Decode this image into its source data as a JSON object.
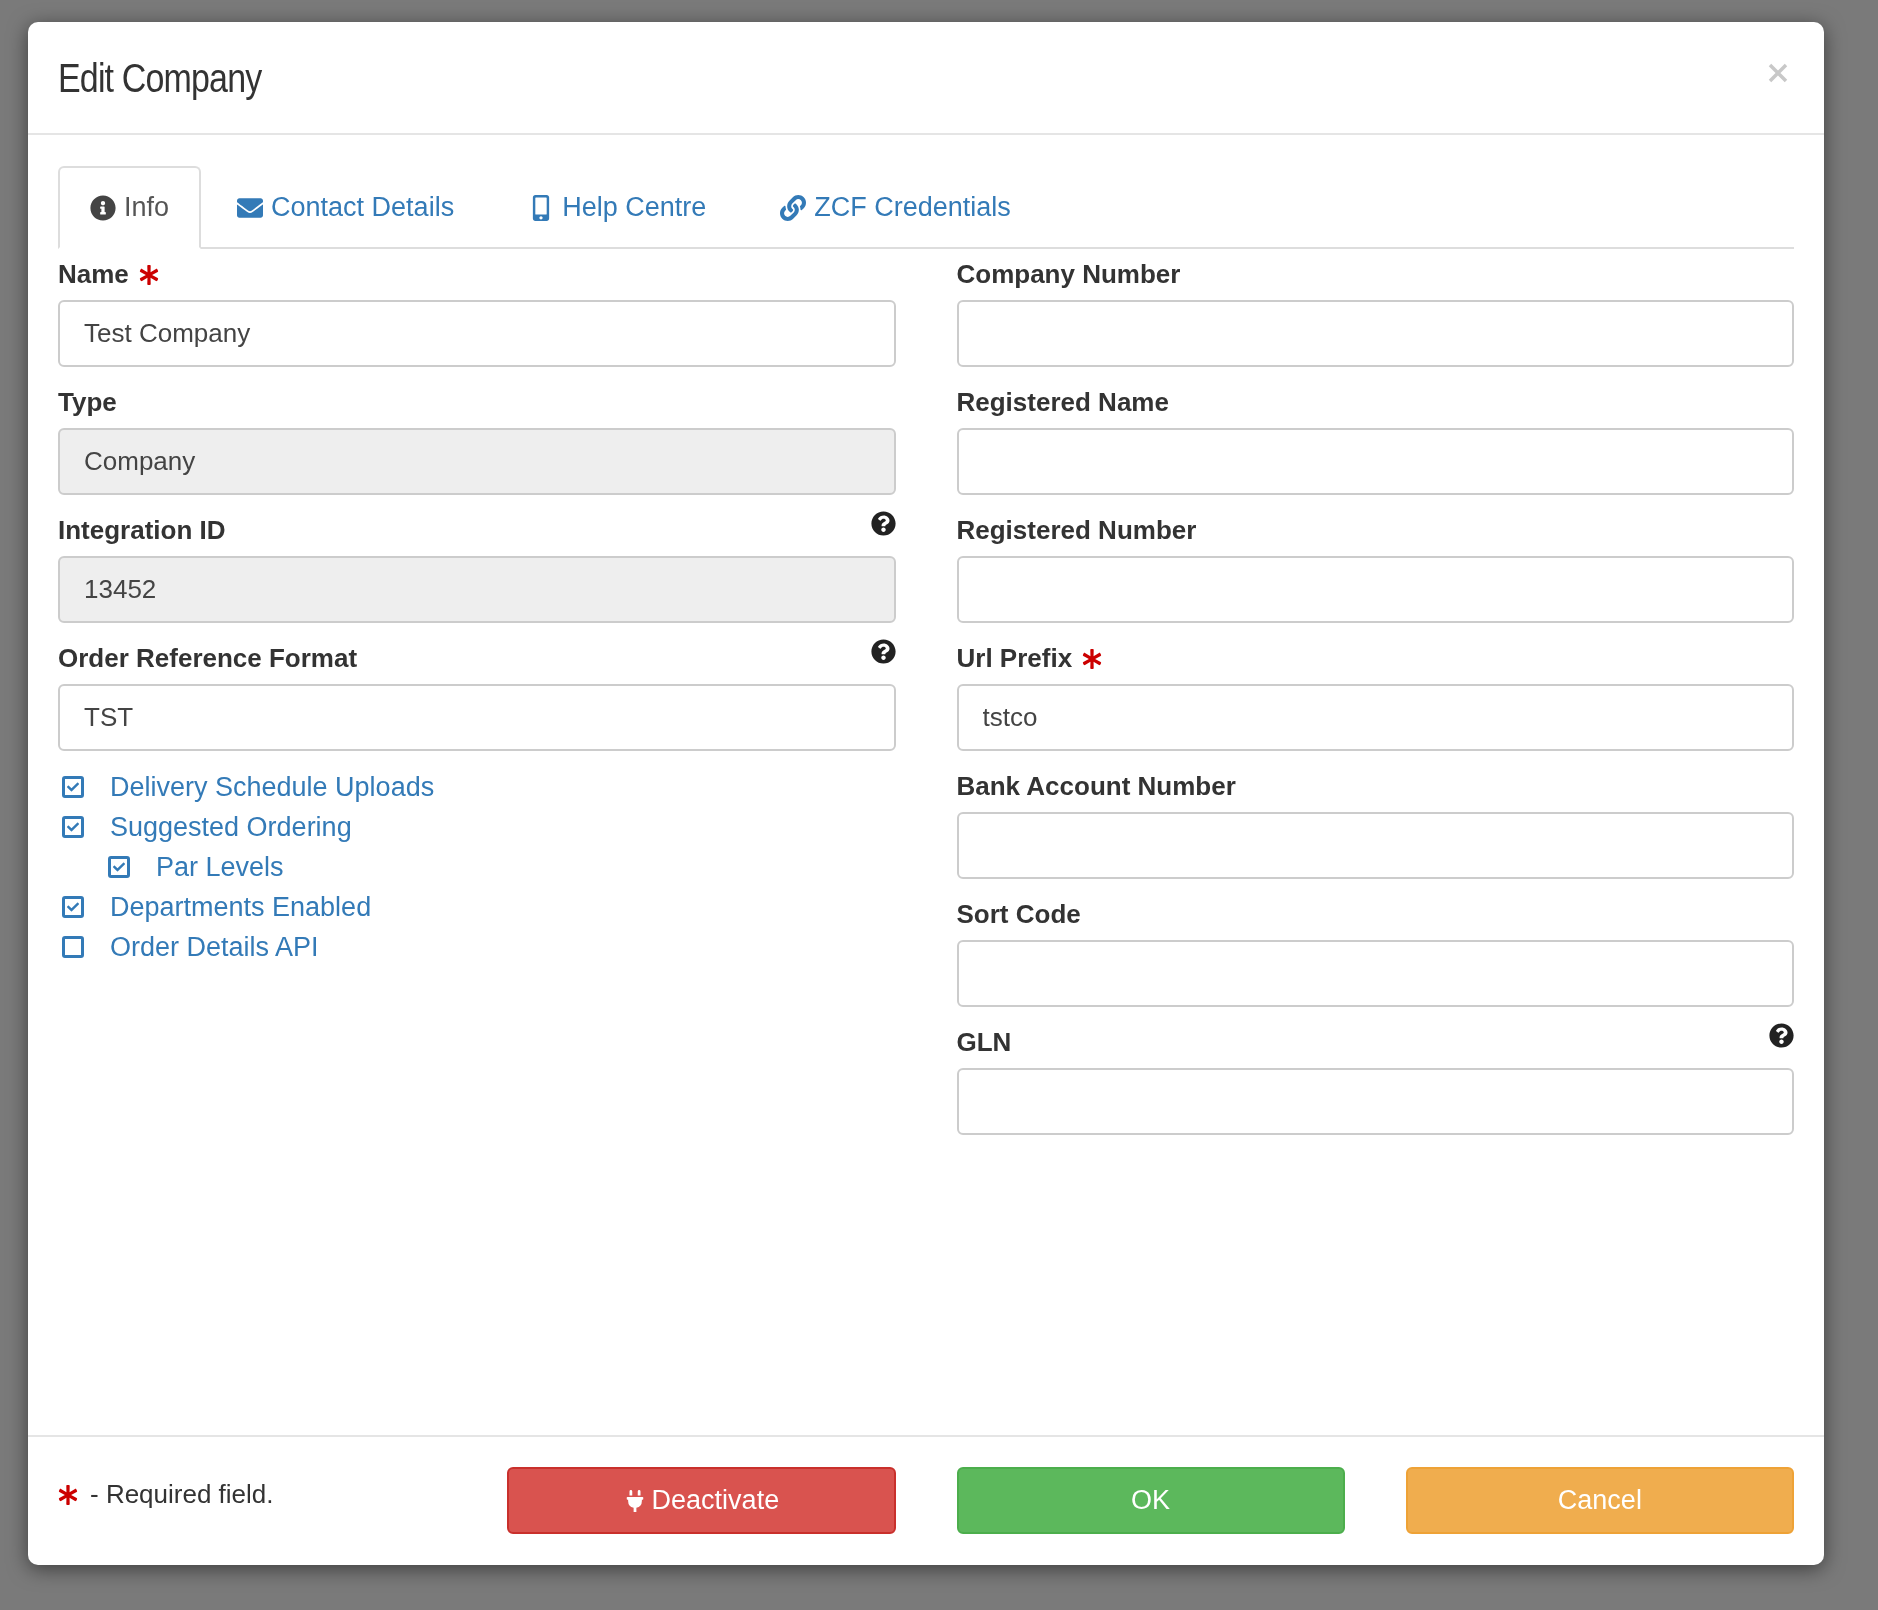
{
  "dialog": {
    "title": "Edit Company"
  },
  "tabs": [
    {
      "label": "Info",
      "selected": true
    },
    {
      "label": "Contact Details",
      "selected": false
    },
    {
      "label": "Help Centre",
      "selected": false
    },
    {
      "label": "ZCF Credentials",
      "selected": false
    }
  ],
  "left_fields": [
    {
      "label": "Name",
      "required": true,
      "help": false,
      "disabled": false,
      "value": "Test Company"
    },
    {
      "label": "Type",
      "required": false,
      "help": false,
      "disabled": true,
      "value": "Company"
    },
    {
      "label": "Integration ID",
      "required": false,
      "help": true,
      "disabled": true,
      "value": "13452"
    },
    {
      "label": "Order Reference Format",
      "required": false,
      "help": true,
      "disabled": false,
      "value": "TST"
    }
  ],
  "options": [
    {
      "label": "Delivery Schedule Uploads",
      "checked": true
    },
    {
      "label": "Suggested Ordering",
      "checked": true,
      "children": [
        {
          "label": "Par Levels",
          "checked": true
        }
      ]
    },
    {
      "label": "Departments Enabled",
      "checked": true
    },
    {
      "label": "Order Details API",
      "checked": false
    }
  ],
  "right_fields": [
    {
      "label": "Company Number",
      "required": false,
      "help": false,
      "disabled": false
    },
    {
      "label": "Registered Name",
      "required": false,
      "help": false,
      "disabled": false
    },
    {
      "label": "Registered Number",
      "required": false,
      "help": false,
      "disabled": false
    },
    {
      "label": "Url Prefix",
      "required": true,
      "help": false,
      "disabled": false,
      "value": "tstco"
    },
    {
      "label": "Bank Account Number",
      "required": false,
      "help": false,
      "disabled": false
    },
    {
      "label": "Sort Code",
      "required": false,
      "help": false,
      "disabled": false
    },
    {
      "label": "GLN",
      "required": false,
      "help": true,
      "disabled": false
    }
  ],
  "footer": {
    "required_note": "- Required field.",
    "buttons": [
      {
        "label": "Deactivate",
        "kind": "danger"
      },
      {
        "label": "OK",
        "kind": "success"
      },
      {
        "label": "Cancel",
        "kind": "warning"
      }
    ]
  }
}
